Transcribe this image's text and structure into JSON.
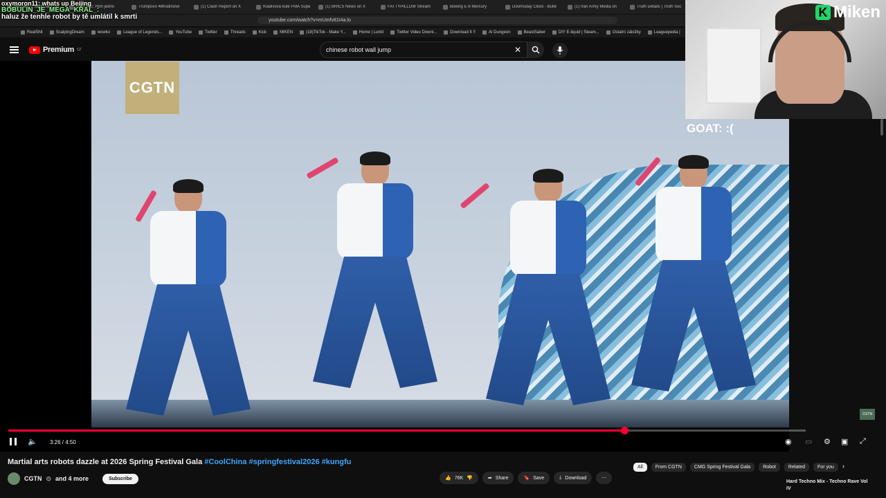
{
  "browser": {
    "tabs": [
      "Seznam – najdu tam, co",
      "ON-LINE: Hoři jedno",
      "Trumpovo 48hodinové",
      "(1) Clash Report on X",
      "Kladivová kule FMA Supe",
      "(1) BRICS News on X",
      "FATTYPILLOW Stream",
      "Boeing E-6 Mercury",
      "Doomsday Clock - Bulle",
      "(1) Iran Army Media on",
      "Truth Details | Truth Soc"
    ],
    "url": "youtube.com/watch?v=mUmfv81I4a.lo",
    "bookmarks": [
      "RealShit",
      "ScalpingDream",
      "wowko",
      "League of Legends...",
      "YouTube",
      "Twitter",
      "Threads",
      "Kick",
      "MIKEN",
      "(18)TikTok - Make Y...",
      "Home | Lurkit",
      "Twitter Video Downl...",
      "Download It !!",
      "AI Dungeon",
      "BeastSaber",
      "DIY E-liquid | Steam...",
      "Ostatní záložky",
      "Leaguepedia |"
    ]
  },
  "chat": {
    "line1": "oxymoron11: whats up Beijing",
    "line2": "BOBULIN_JE_MEGA_KRAL_:",
    "line3": "haluz že tenhle robot by tě umlátil k smrti"
  },
  "youtube": {
    "logo": "Premium",
    "logo_region": "CZ",
    "search_query": "chinese robot wall jump"
  },
  "video": {
    "watermark": "CGTN",
    "corner_watermark": "CGTN",
    "time": "3:26 / 4:50",
    "progress": 0.773
  },
  "overlay": {
    "brand": "Miken",
    "brand_letter": "K",
    "goat_text": "GOAT: :("
  },
  "meta": {
    "title": "Martial arts robots dazzle at 2026 Spring Festival Gala",
    "tags": "#CoolChina #springfestival2026 #kungfu",
    "channel": "CGTN",
    "channel_suffix": "and 4 more",
    "subscribe": "Subscribe",
    "likes": "76K",
    "share": "Share",
    "save": "Save",
    "download": "Download"
  },
  "chips": [
    "All",
    "From CGTN",
    "CMG Spring Festival Gala",
    "Robot",
    "Related",
    "For you"
  ],
  "next_video": "Hard Techno Mix - Techno Rave Vol IV",
  "colors": {
    "accent": "#ff0033",
    "link": "#3ea6ff",
    "brand_green": "#24d36b"
  }
}
